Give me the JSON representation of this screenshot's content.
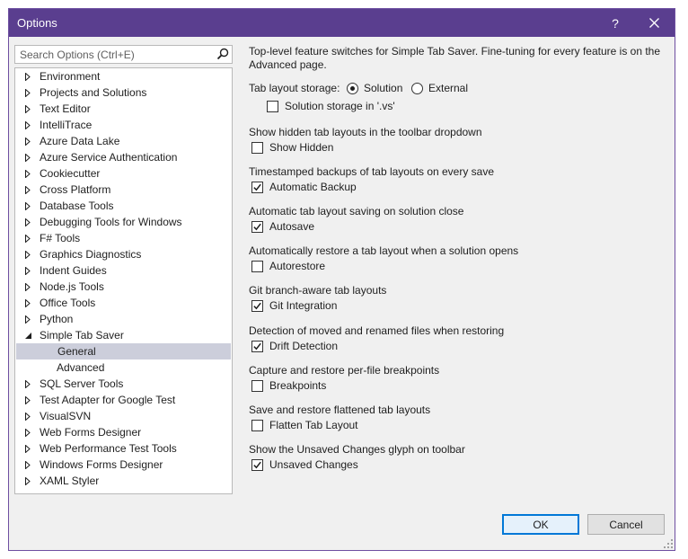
{
  "window": {
    "title": "Options",
    "help_label": "?"
  },
  "search": {
    "placeholder": "Search Options (Ctrl+E)",
    "value": ""
  },
  "tree": {
    "items": [
      {
        "label": "Environment",
        "state": "collapsed",
        "level": 0
      },
      {
        "label": "Projects and Solutions",
        "state": "collapsed",
        "level": 0
      },
      {
        "label": "Text Editor",
        "state": "collapsed",
        "level": 0
      },
      {
        "label": "IntelliTrace",
        "state": "collapsed",
        "level": 0
      },
      {
        "label": "Azure Data Lake",
        "state": "collapsed",
        "level": 0
      },
      {
        "label": "Azure Service Authentication",
        "state": "collapsed",
        "level": 0
      },
      {
        "label": "Cookiecutter",
        "state": "collapsed",
        "level": 0
      },
      {
        "label": "Cross Platform",
        "state": "collapsed",
        "level": 0
      },
      {
        "label": "Database Tools",
        "state": "collapsed",
        "level": 0
      },
      {
        "label": "Debugging Tools for Windows",
        "state": "collapsed",
        "level": 0
      },
      {
        "label": "F# Tools",
        "state": "collapsed",
        "level": 0
      },
      {
        "label": "Graphics Diagnostics",
        "state": "collapsed",
        "level": 0
      },
      {
        "label": "Indent Guides",
        "state": "collapsed",
        "level": 0
      },
      {
        "label": "Node.js Tools",
        "state": "collapsed",
        "level": 0
      },
      {
        "label": "Office Tools",
        "state": "collapsed",
        "level": 0
      },
      {
        "label": "Python",
        "state": "collapsed",
        "level": 0
      },
      {
        "label": "Simple Tab Saver",
        "state": "expanded",
        "level": 0
      },
      {
        "label": "General",
        "state": "leaf",
        "level": 1,
        "selected": true
      },
      {
        "label": "Advanced",
        "state": "leaf",
        "level": 1
      },
      {
        "label": "SQL Server Tools",
        "state": "collapsed",
        "level": 0
      },
      {
        "label": "Test Adapter for Google Test",
        "state": "collapsed",
        "level": 0
      },
      {
        "label": "VisualSVN",
        "state": "collapsed",
        "level": 0
      },
      {
        "label": "Web Forms Designer",
        "state": "collapsed",
        "level": 0
      },
      {
        "label": "Web Performance Test Tools",
        "state": "collapsed",
        "level": 0
      },
      {
        "label": "Windows Forms Designer",
        "state": "collapsed",
        "level": 0
      },
      {
        "label": "XAML Styler",
        "state": "collapsed",
        "level": 0
      }
    ]
  },
  "panel": {
    "description": "Top-level feature switches for Simple Tab Saver. Fine-tuning for every feature is on the Advanced page.",
    "storage": {
      "label": "Tab layout storage:",
      "options": [
        {
          "label": "Solution",
          "selected": true
        },
        {
          "label": "External",
          "selected": false
        }
      ],
      "solution_storage": {
        "label": "Solution storage in '.vs'",
        "checked": false
      }
    },
    "options": [
      {
        "description": "Show hidden tab layouts in the toolbar dropdown",
        "label": "Show Hidden",
        "checked": false
      },
      {
        "description": "Timestamped backups of tab layouts on every save",
        "label": "Automatic Backup",
        "checked": true
      },
      {
        "description": "Automatic tab layout saving on solution close",
        "label": "Autosave",
        "checked": true
      },
      {
        "description": "Automatically restore a tab layout when a solution opens",
        "label": "Autorestore",
        "checked": false
      },
      {
        "description": "Git branch-aware tab layouts",
        "label": "Git Integration",
        "checked": true
      },
      {
        "description": "Detection of moved and renamed files when restoring",
        "label": "Drift Detection",
        "checked": true
      },
      {
        "description": "Capture and restore per-file breakpoints",
        "label": "Breakpoints",
        "checked": false
      },
      {
        "description": "Save and restore flattened tab layouts",
        "label": "Flatten Tab Layout",
        "checked": false
      },
      {
        "description": "Show the Unsaved Changes glyph on toolbar",
        "label": "Unsaved Changes",
        "checked": true
      }
    ]
  },
  "buttons": {
    "ok": "OK",
    "cancel": "Cancel"
  },
  "colors": {
    "titlebar": "#5a3e8f",
    "selection": "#cccedb",
    "ok_border": "#0078d7"
  }
}
